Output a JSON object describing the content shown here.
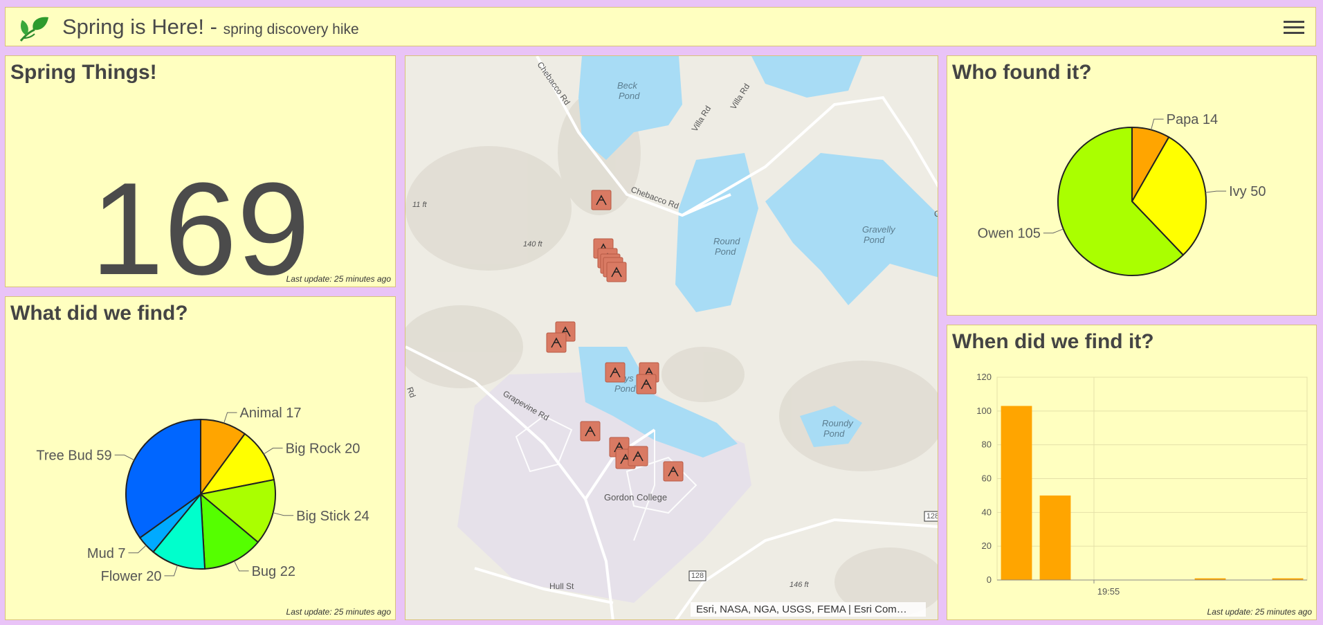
{
  "header": {
    "title": "Spring is Here!",
    "separator": " - ",
    "subtitle": "spring discovery hike"
  },
  "count_panel": {
    "title": "Spring Things!",
    "value": "169",
    "last_update": "Last update: 25 minutes ago"
  },
  "what_panel": {
    "title": "What did we find?",
    "last_update": "Last update: 25 minutes ago",
    "chart_data": {
      "type": "pie",
      "slices": [
        {
          "label": "Animal 17",
          "value": 17,
          "color": "#ffa500"
        },
        {
          "label": "Big Rock 20",
          "value": 20,
          "color": "#ffff00"
        },
        {
          "label": "Big Stick 24",
          "value": 24,
          "color": "#aaff00"
        },
        {
          "label": "Bug 22",
          "value": 22,
          "color": "#55ff00"
        },
        {
          "label": "Flower 20",
          "value": 20,
          "color": "#00ffcc"
        },
        {
          "label": "Mud 7",
          "value": 7,
          "color": "#00aaff"
        },
        {
          "label": "Tree Bud 59",
          "value": 59,
          "color": "#0066ff"
        }
      ]
    }
  },
  "who_panel": {
    "title": "Who found it?",
    "chart_data": {
      "type": "pie",
      "slices": [
        {
          "label": "Papa 14",
          "value": 14,
          "color": "#ffa500"
        },
        {
          "label": "Ivy 50",
          "value": 50,
          "color": "#ffff00"
        },
        {
          "label": "Owen 105",
          "value": 105,
          "color": "#aaff00"
        }
      ]
    }
  },
  "when_panel": {
    "title": "When did we find it?",
    "last_update": "Last update: 25 minutes ago",
    "chart_data": {
      "type": "bar",
      "ylim": [
        0,
        120
      ],
      "yticks": [
        0,
        20,
        40,
        60,
        80,
        100,
        120
      ],
      "x_tick_label": "19:55",
      "color": "#ffa500",
      "bins": [
        103,
        50,
        0,
        0,
        0,
        1,
        0,
        1
      ]
    }
  },
  "map": {
    "attribution": "Esri, NASA, NGA, USGS, FEMA | Esri Com…",
    "labels": [
      {
        "text": "Chebacco Rd",
        "kind": "road"
      },
      {
        "text": "Villa Rd",
        "kind": "road"
      },
      {
        "text": "Villa Rd",
        "kind": "road"
      },
      {
        "text": "Chebacco Rd",
        "kind": "road"
      },
      {
        "text": "Beck",
        "kind": "water"
      },
      {
        "text": "Pond",
        "kind": "water"
      },
      {
        "text": "Round",
        "kind": "water"
      },
      {
        "text": "Pond",
        "kind": "water"
      },
      {
        "text": "Gravelly",
        "kind": "water"
      },
      {
        "text": "Pond",
        "kind": "water"
      },
      {
        "text": "Coys",
        "kind": "water"
      },
      {
        "text": "Pond",
        "kind": "water"
      },
      {
        "text": "Roundy",
        "kind": "water"
      },
      {
        "text": "Pond",
        "kind": "water"
      },
      {
        "text": "Grapevine Rd",
        "kind": "road"
      },
      {
        "text": "Gordon College",
        "kind": "place"
      },
      {
        "text": "Hull St",
        "kind": "road"
      },
      {
        "text": "140 ft",
        "kind": "elev"
      },
      {
        "text": "146 ft",
        "kind": "elev"
      },
      {
        "text": "11 ft",
        "kind": "elev"
      },
      {
        "text": "Rd",
        "kind": "road"
      },
      {
        "text": "128",
        "kind": "shield"
      },
      {
        "text": "128",
        "kind": "shield"
      },
      {
        "text": "C",
        "kind": "road"
      }
    ]
  }
}
